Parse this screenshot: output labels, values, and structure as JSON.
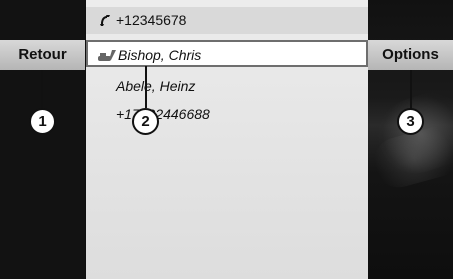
{
  "left_button": {
    "label": "Retour"
  },
  "right_button": {
    "label": "Options"
  },
  "list": {
    "header_number": "+12345678",
    "selected_entry": "Bishop, Chris",
    "entry2": "Abele, Heinz",
    "entry3": "+17822446688"
  },
  "callouts": [
    "1",
    "2",
    "3"
  ],
  "icons": {
    "header": "phone-handset-icon",
    "selected": "pen-phone-icon"
  },
  "colors": {
    "bg": "#0f0f0f",
    "list_bg": "#e6e6e6",
    "button_bg": "#c8c8c8",
    "callout_fill": "#ffffff"
  }
}
